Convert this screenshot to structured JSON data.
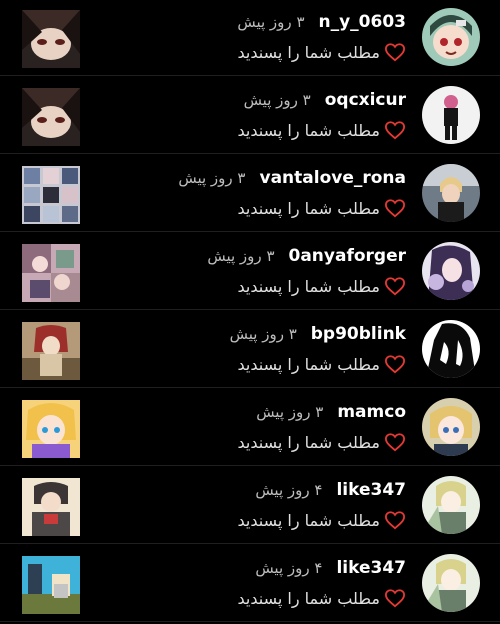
{
  "notifications": [
    {
      "username": "n_y_0603",
      "time": "۳ روز پیش",
      "action": "مطلب شما را پسندید"
    },
    {
      "username": "oqcxicur",
      "time": "۳ روز پیش",
      "action": "مطلب شما را پسندید"
    },
    {
      "username": "vantalove_rona",
      "time": "۳ روز پیش",
      "action": "مطلب شما را پسندید"
    },
    {
      "username": "0anyaforger",
      "time": "۳ روز پیش",
      "action": "مطلب شما را پسندید"
    },
    {
      "username": "bp90blink",
      "time": "۳ روز پیش",
      "action": "مطلب شما را پسندید"
    },
    {
      "username": "mamco",
      "time": "۳ روز پیش",
      "action": "مطلب شما را پسندید"
    },
    {
      "username": "like347",
      "time": "۴ روز پیش",
      "action": "مطلب شما را پسندید"
    },
    {
      "username": "like347",
      "time": "۴ روز پیش",
      "action": "مطلب شما را پسندید"
    }
  ],
  "colors": {
    "background": "#000000",
    "heart": "#e53935",
    "divider": "#1f1f1f"
  },
  "icons": {
    "like": "heart-outline-icon"
  }
}
